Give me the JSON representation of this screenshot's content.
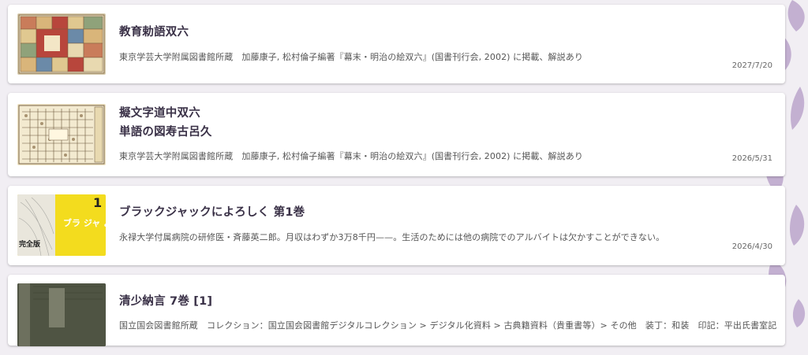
{
  "items": [
    {
      "title": "教育勅語双六",
      "description": "東京学芸大学附属図書館所蔵　加藤康子, 松村倫子編著『幕末・明治の絵双六』(国書刊行会, 2002) に掲載、解説あり",
      "date": "2027/7/20",
      "thumbnail_icon": "sugoroku-board-thumbnail"
    },
    {
      "title": "擬文字道中双六",
      "subtitle": "単語の図寿古呂久",
      "description": "東京学芸大学附属図書館所蔵　加藤康子, 松村倫子編著『幕末・明治の絵双六』(国書刊行会, 2002) に掲載、解説あり",
      "date": "2026/5/31",
      "thumbnail_icon": "sugoroku-board-thumbnail"
    },
    {
      "title": "ブラックジャックによろしく 第1巻",
      "description": "永禄大学付属病院の研修医・斉藤英二郎。月収はわずか3万8千円——。生活のためには他の病院でのアルバイトは欠かすことができない。",
      "date": "2026/4/30",
      "thumbnail_icon": "manga-cover-thumbnail",
      "thumbnail_text": {
        "volume": "1",
        "title_fragment": "ブラ ジャ よろ",
        "edition": "完全版"
      }
    },
    {
      "title": "清少納言 7巻 [1]",
      "description": "国立国会図書館所蔵　コレクション：国立国会図書館デジタルコレクション > デジタル化資料 > 古典籍資料（貴重書等）> その他　装丁：和装　印記：平出氏書室記",
      "thumbnail_icon": "old-book-thumbnail"
    }
  ],
  "colors": {
    "background": "#f1eef3",
    "card": "#ffffff",
    "title": "#3a3147",
    "pattern": "#b7a0c8",
    "manga_yellow": "#f3dc1e"
  }
}
